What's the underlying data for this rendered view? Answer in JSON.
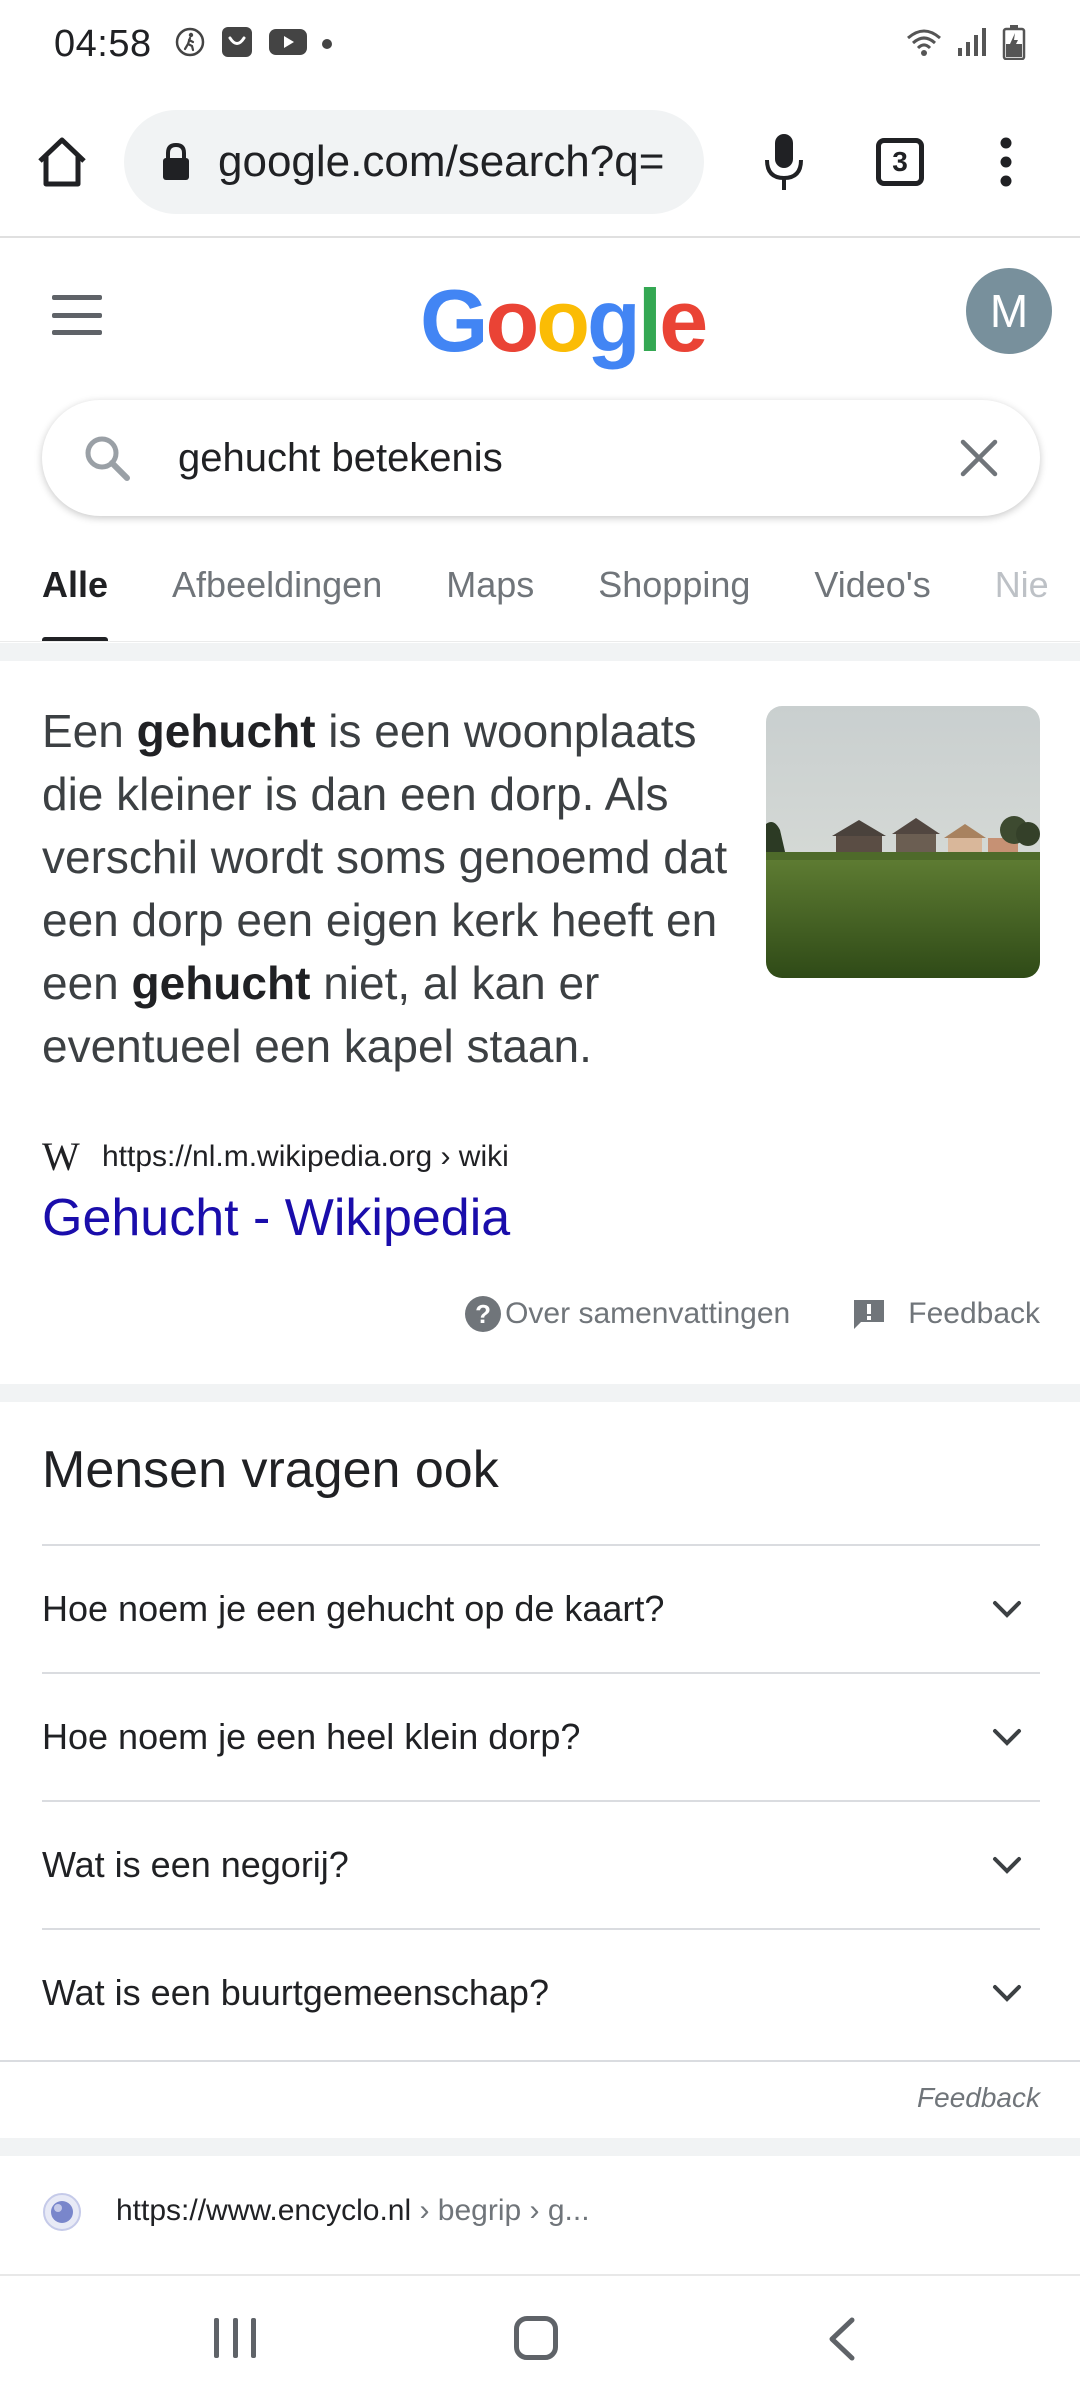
{
  "status_bar": {
    "time": "04:58",
    "left_icons": [
      "walk-icon",
      "shopping-bag-icon",
      "youtube-icon",
      "dot-icon"
    ],
    "right_icons": [
      "wifi-icon",
      "signal-icon",
      "battery-charging-icon"
    ]
  },
  "browser": {
    "url": "google.com/search?q=",
    "tab_count": "3",
    "icons": [
      "home-icon",
      "lock-icon",
      "mic-icon",
      "tabs-icon",
      "more-vert-icon"
    ]
  },
  "google": {
    "logo_letters": [
      "G",
      "o",
      "o",
      "g",
      "l",
      "e"
    ],
    "logo_colors": [
      "#4285F4",
      "#EA4335",
      "#FBBC05",
      "#4285F4",
      "#34A853",
      "#EA4335"
    ],
    "avatar_initial": "M",
    "avatar_color": "#78909c"
  },
  "search": {
    "query": "gehucht betekenis"
  },
  "tabs": [
    {
      "label": "Alle",
      "active": true
    },
    {
      "label": "Afbeeldingen",
      "active": false
    },
    {
      "label": "Maps",
      "active": false
    },
    {
      "label": "Shopping",
      "active": false
    },
    {
      "label": "Video's",
      "active": false
    },
    {
      "label": "Nie",
      "active": false
    }
  ],
  "snippet": {
    "parts": [
      {
        "text": "Een ",
        "bold": false
      },
      {
        "text": "gehucht",
        "bold": true
      },
      {
        "text": " is een woonplaats die kleiner is dan een dorp. Als verschil wordt soms genoemd dat een dorp een eigen kerk heeft en een ",
        "bold": false
      },
      {
        "text": "gehucht",
        "bold": true
      },
      {
        "text": " niet, al kan er eventueel een kapel staan.",
        "bold": false
      }
    ],
    "source_icon_letter": "W",
    "source_url": "https://nl.m.wikipedia.org › wiki",
    "title": "Gehucht - Wikipedia",
    "title_color": "#1a0dab",
    "about_label": "Over samenvattingen",
    "feedback_label": "Feedback"
  },
  "people_also_ask": {
    "title": "Mensen vragen ook",
    "questions": [
      "Hoe noem je een gehucht op de kaart?",
      "Hoe noem je een heel klein dorp?",
      "Wat is een negorij?",
      "Wat is een buurtgemeenschap?"
    ],
    "feedback_label": "Feedback"
  },
  "next_result": {
    "url_main": "https://www.encyclo.nl",
    "url_path": " › begrip › g..."
  }
}
